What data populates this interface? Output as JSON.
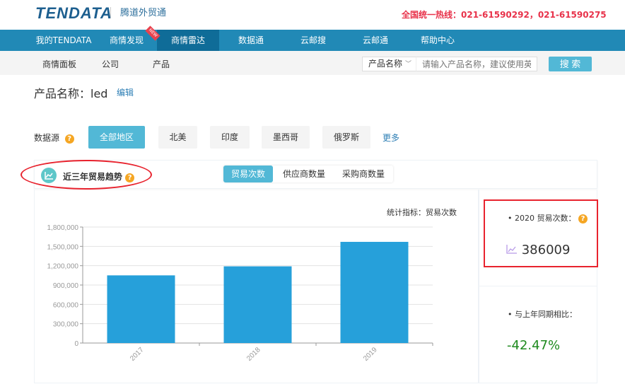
{
  "header": {
    "logo": "TENDATA",
    "logo_subtitle": "腾道外贸通",
    "hotline": "全国统一热线：021-61590292，021-61590275"
  },
  "nav": {
    "items": [
      {
        "label": "我的TENDATA"
      },
      {
        "label": "商情发现",
        "badge": "NEW"
      },
      {
        "label": "商情雷达",
        "active": true
      },
      {
        "label": "数据通"
      },
      {
        "label": "云邮搜"
      },
      {
        "label": "云邮通"
      },
      {
        "label": "帮助中心"
      }
    ]
  },
  "subnav": {
    "items": [
      "商情面板",
      "公司",
      "产品"
    ],
    "active": "产品",
    "search_type": "产品名称",
    "search_placeholder": "请输入产品名称，建议使用英文",
    "search_button": "搜 索"
  },
  "product": {
    "label": "产品名称：",
    "value": "led",
    "edit": "编辑"
  },
  "data_source": {
    "label": "数据源",
    "chips": [
      "全部地区",
      "北美",
      "印度",
      "墨西哥",
      "俄罗斯"
    ],
    "active": "全部地区",
    "more": "更多"
  },
  "trend": {
    "title": "近三年贸易趋势",
    "tabs": [
      "贸易次数",
      "供应商数量",
      "采购商数量"
    ],
    "active_tab": "贸易次数",
    "metric_label": "统计指标：贸易次数"
  },
  "chart_data": {
    "type": "bar",
    "categories": [
      "2017",
      "2018",
      "2019"
    ],
    "values": [
      1050000,
      1190000,
      1570000
    ],
    "ylim": [
      0,
      1800000
    ],
    "yticks": [
      "0",
      "300,000",
      "600,000",
      "900,000",
      "1,200,000",
      "1,500,000",
      "1,800,000"
    ],
    "grid": true,
    "bar_color": "#26a0da"
  },
  "stats": {
    "current_label": "2020 贸易次数：",
    "current_value": "386009",
    "compare_label": "与上年同期相比：",
    "compare_value": "-42.47%",
    "compare_color": "#1e8a1e"
  },
  "colors": {
    "nav": "#2189b6",
    "accent": "#52b8d6",
    "hotline": "#e8324a"
  }
}
